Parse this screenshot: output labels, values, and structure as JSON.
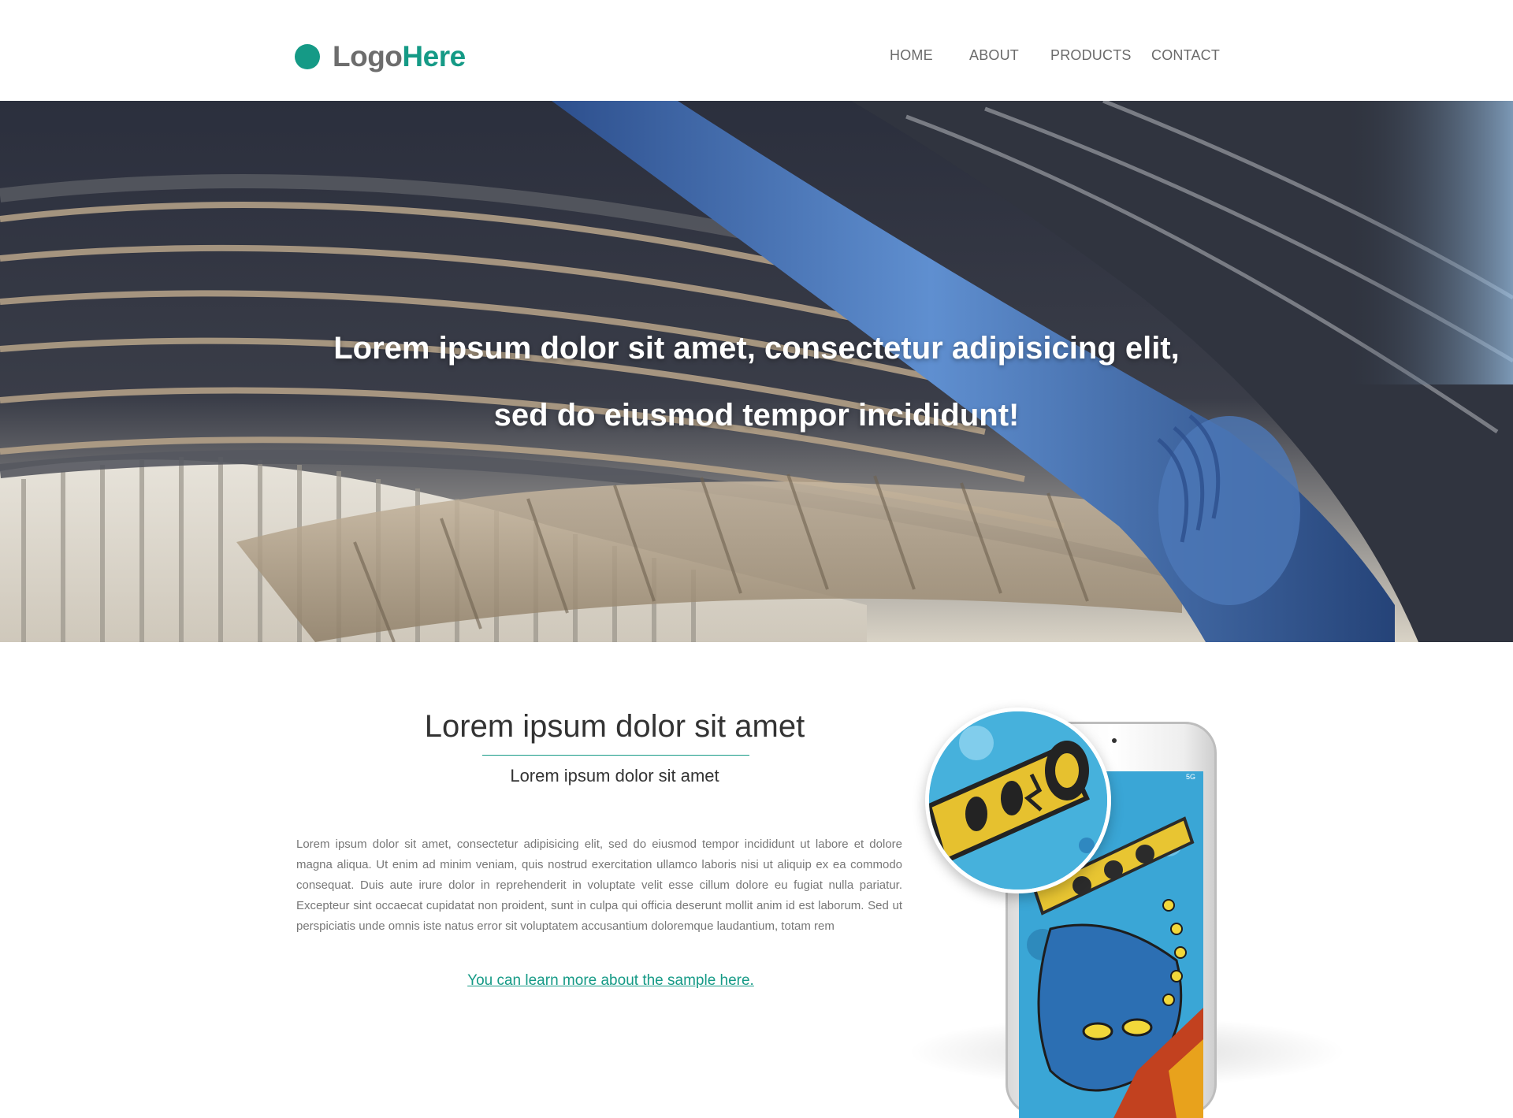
{
  "header": {
    "logo_part1": "Logo",
    "logo_part2": "Here",
    "nav": [
      {
        "label": "HOME"
      },
      {
        "label": "ABOUT"
      },
      {
        "label": "PRODUCTS"
      },
      {
        "label": "CONTACT"
      }
    ]
  },
  "hero": {
    "line1": "Lorem ipsum dolor sit amet, consectetur adipisicing elit,",
    "line2": "sed do eiusmod tempor incididunt!"
  },
  "content": {
    "title": "Lorem ipsum dolor sit amet",
    "subtitle": "Lorem ipsum dolor sit amet",
    "body": "Lorem ipsum dolor sit amet, consectetur adipisicing elit, sed do eiusmod tempor incididunt ut labore et dolore magna aliqua. Ut enim ad minim veniam, quis nostrud exercitation ullamco laboris nisi ut aliquip ex ea commodo consequat. Duis aute irure dolor in reprehenderit in voluptate velit esse cillum dolore eu fugiat nulla pariatur. Excepteur sint occaecat cupidatat non proident, sunt in culpa qui officia deserunt mollit anim id est laborum. Sed ut perspiciatis unde omnis iste natus error sit voluptatem accusantium doloremque laudantium, totam rem",
    "link": "You can learn more about the sample here."
  },
  "phone": {
    "status": "5G"
  },
  "colors": {
    "accent": "#159a86",
    "nav_text": "#6a6a6a",
    "body_text": "#777777"
  },
  "icons": {
    "logo_mark": "circle-dot-icon"
  }
}
